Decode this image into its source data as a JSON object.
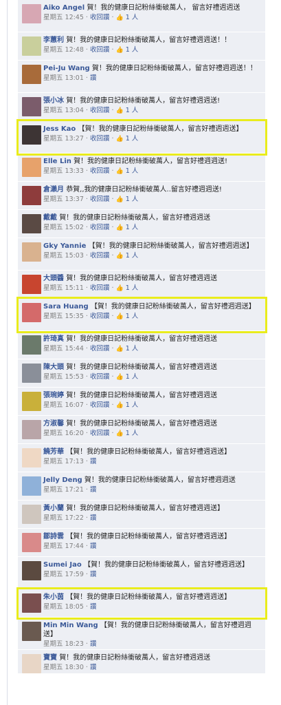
{
  "comments": [
    {
      "name": "Aiko Angel",
      "text": "賀！我的健康日記粉絲衝破萬人， 留言好禮週週送",
      "time": "星期五 12:45",
      "action": "收回讚",
      "likes": "1 人",
      "avatar_color": "#d7a7b3"
    },
    {
      "name": "李蕙利",
      "text": "賀！我的健康日記粉絲衝破萬人，留言好禮週週送！！",
      "time": "星期五 12:48",
      "action": "收回讚",
      "likes": "1 人",
      "avatar_color": "#c9cf9c"
    },
    {
      "name": "Pei-Ju Wang",
      "text": "賀！我的健康日記粉絲衝破萬人，留言好禮週週送！！",
      "time": "星期五 13:01",
      "action": "讚",
      "likes": "",
      "avatar_color": "#a86b3a"
    },
    {
      "name": "張小冰",
      "text": "賀！我的健康日記粉絲衝破萬人，留言好禮週週送!",
      "time": "星期五 13:04",
      "action": "收回讚",
      "likes": "1 人",
      "avatar_color": "#7b5c6b"
    },
    {
      "name": "Jess Kao",
      "text": "【賀！我的健康日記粉絲衝破萬人，留言好禮週週送】",
      "time": "星期五 13:27",
      "action": "收回讚",
      "likes": "1 人",
      "avatar_color": "#3d3434"
    },
    {
      "name": "Elle Lin",
      "text": "賀！我的健康日記粉絲衝破萬人，留言好禮週週送!",
      "time": "星期五 13:33",
      "action": "收回讚",
      "likes": "1 人",
      "avatar_color": "#e7a26b"
    },
    {
      "name": "倉瀨月",
      "text": "恭賀,,我的健康日記粉絲衝破萬人..留言好禮週週送!",
      "time": "星期五 13:37",
      "action": "收回讚",
      "likes": "1 人",
      "avatar_color": "#8e3c3c"
    },
    {
      "name": "戴戴",
      "text": "賀！我的健康日記粉絲衝破萬人，留言好禮週週送",
      "time": "星期五 15:02",
      "action": "收回讚",
      "likes": "1 人",
      "avatar_color": "#5a4a44"
    },
    {
      "name": "Gky Yannie",
      "text": "【賀！我的健康日記粉絲衝破萬人，留言好禮週週送】",
      "time": "星期五 15:03",
      "action": "收回讚",
      "likes": "1 人",
      "avatar_color": "#d9b28f"
    },
    {
      "name": "大頭醬",
      "text": "賀！我的健康日記粉絲衝破萬人，留言好禮週週送",
      "time": "星期五 15:11",
      "action": "收回讚",
      "likes": "1 人",
      "avatar_color": "#c8452f"
    },
    {
      "name": "Sara Huang",
      "text": "【賀！我的健康日記粉絲衝破萬人，留言好禮週週送】",
      "time": "星期五 15:35",
      "action": "收回讚",
      "likes": "1 人",
      "avatar_color": "#d46a6a"
    },
    {
      "name": "許琦真",
      "text": "賀！我的健康日記粉絲衝破萬人，留言好禮週週送",
      "time": "星期五 15:44",
      "action": "收回讚",
      "likes": "1 人",
      "avatar_color": "#6b7a6b"
    },
    {
      "name": "陳大頭",
      "text": "賀！我的健康日記粉絲衝破萬人，留言好禮週週送",
      "time": "星期五 15:53",
      "action": "收回讚",
      "likes": "1 人",
      "avatar_color": "#8a8f99"
    },
    {
      "name": "張琬婷",
      "text": "賀！我的健康日記粉絲衝破萬人，留言好禮週週送",
      "time": "星期五 16:07",
      "action": "收回讚",
      "likes": "1 人",
      "avatar_color": "#c9b03a"
    },
    {
      "name": "方淑馨",
      "text": "賀！我的健康日記粉絲衝破萬人，留言好禮週週送",
      "time": "星期五 16:20",
      "action": "收回讚",
      "likes": "1 人",
      "avatar_color": "#b9a5a8"
    },
    {
      "name": "饒芳華",
      "text": "【賀！我的健康日記粉絲衝破萬人，留言好禮週週送】",
      "time": "星期五 17:13",
      "action": "讚",
      "likes": "",
      "avatar_color": "#efd8c4"
    },
    {
      "name": "Jelly Deng",
      "text": "賀！我的健康日記粉絲衝破萬人，留言好禮週週送",
      "time": "星期五 17:21",
      "action": "讚",
      "likes": "",
      "avatar_color": "#8fb1d9"
    },
    {
      "name": "黃小蘭",
      "text": "賀！我的健康日記粉絲衝破萬人，留言好禮週週送】",
      "time": "星期五 17:22",
      "action": "讚",
      "likes": "",
      "avatar_color": "#cfc6be"
    },
    {
      "name": "鄒詩雲",
      "text": "【賀！我的健康日記粉絲衝破萬人，留言好禮週週送】",
      "time": "星期五 17:44",
      "action": "讚",
      "likes": "",
      "avatar_color": "#d98a8a"
    },
    {
      "name": "Sumei Jao",
      "text": "【賀！我的健康日記粉絲衝破萬人，留言好禮週週送】",
      "time": "星期五 17:59",
      "action": "讚",
      "likes": "",
      "avatar_color": "#5b4a40"
    },
    {
      "name": "朱小茵",
      "text": "【賀！我的健康日記粉絲衝破萬人，留言好禮週週送】",
      "time": "星期五 18:05",
      "action": "讚",
      "likes": "",
      "avatar_color": "#7a4f4f"
    },
    {
      "name": "Min Min Wang",
      "text": "【賀！我的健康日記粉絲衝破萬人，留言好禮週週送】",
      "time": "星期五 18:23",
      "action": "讚",
      "likes": "",
      "avatar_color": "#6a5a50"
    },
    {
      "name": "寶寶",
      "text": "賀！我的健康日記粉絲衝破萬人，留言好禮週週送",
      "time": "星期五 18:30",
      "action": "讚",
      "likes": "",
      "avatar_color": "#e8d6c6"
    }
  ],
  "highlighted": [
    4,
    10,
    20
  ],
  "highlight_color": "#e9ec1c",
  "link_color": "#3b5998",
  "row_background": "#edeff4"
}
